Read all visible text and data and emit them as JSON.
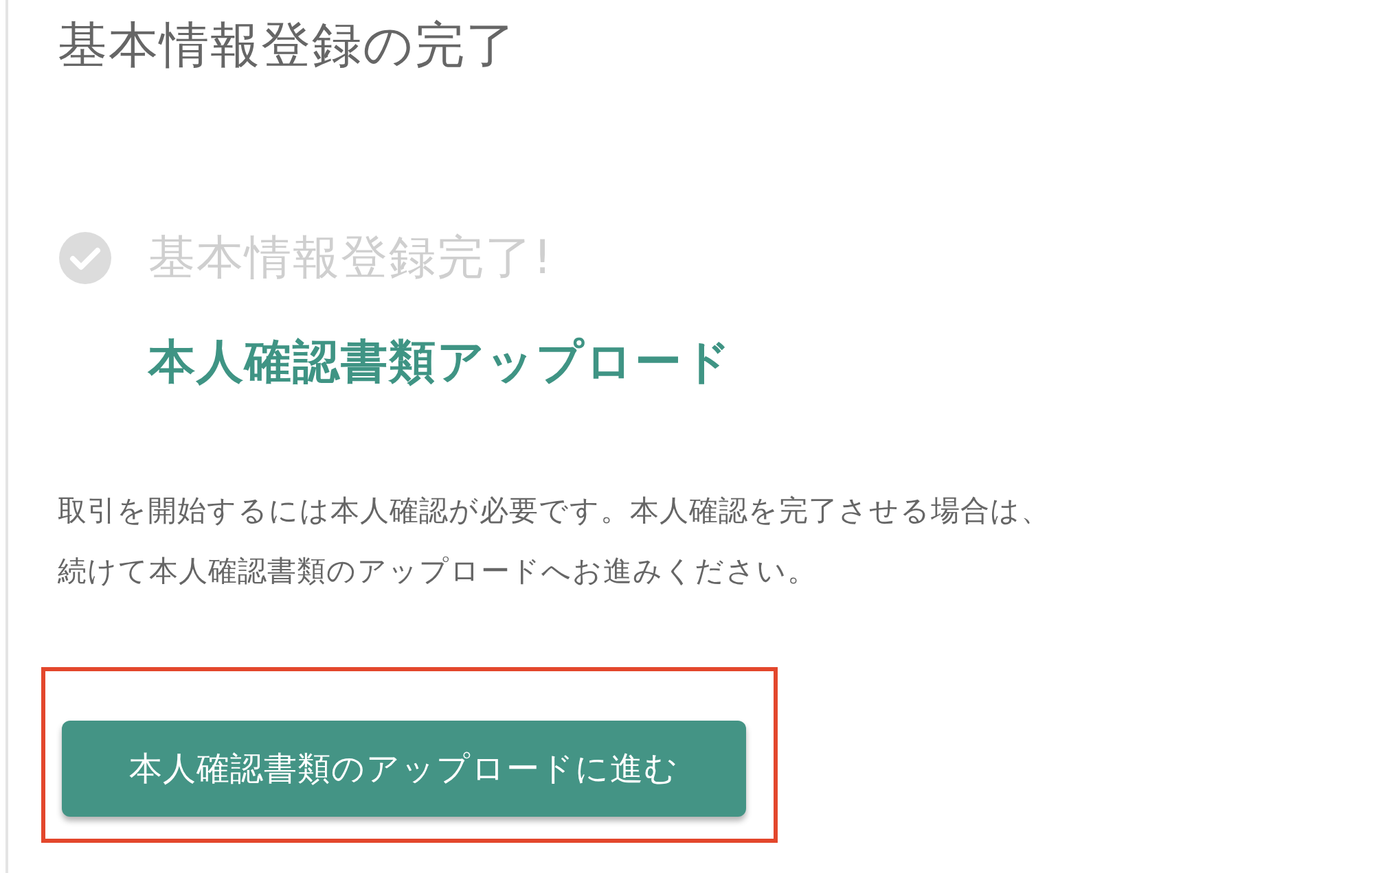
{
  "title": "基本情報登録の完了",
  "steps": [
    {
      "label": "基本情報登録完了!",
      "completed": true
    },
    {
      "label": "本人確認書類アップロード",
      "completed": false
    }
  ],
  "message": [
    "取引を開始するには本人確認が必要です。本人確認を完了させる場合は、",
    "続けて本人確認書類のアップロードへお進みください。"
  ],
  "button": {
    "label": "本人確認書類のアップロードに進む",
    "highlighted": true
  }
}
